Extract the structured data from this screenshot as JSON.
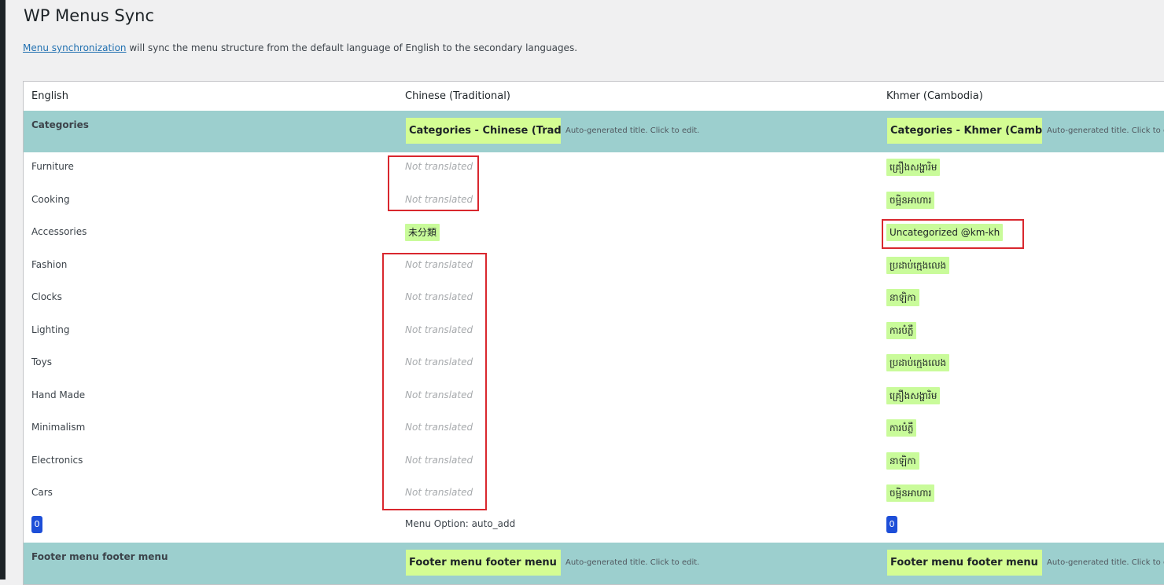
{
  "page": {
    "title": "WP Menus Sync",
    "intro_link": "Menu synchronization",
    "intro_text": " will sync the menu structure from the default language of English to the secondary languages."
  },
  "table": {
    "headers": [
      "English",
      "Chinese (Traditional)",
      "Khmer (Cambodia)"
    ],
    "groups": [
      {
        "label": "Categories",
        "zh_title": "Categories - Chinese (Traditional)",
        "km_title": "Categories - Khmer (Cambodia)",
        "auto_note": "Auto-generated title. Click to edit.",
        "rows": [
          {
            "en": "Furniture",
            "zh": "Not translated",
            "km": "គ្រឿងសង្ហារិម"
          },
          {
            "en": "Cooking",
            "zh": "Not translated",
            "km": "ចម្អិនអាហារ"
          },
          {
            "en": "Accessories",
            "zh": "未分類",
            "km": "Uncategorized @km-kh"
          },
          {
            "en": "Fashion",
            "zh": "Not translated",
            "km": "ប្រដាប់ក្មេងលេង"
          },
          {
            "en": "Clocks",
            "zh": "Not translated",
            "km": "នាឡិកា"
          },
          {
            "en": "Lighting",
            "zh": "Not translated",
            "km": "ការបំភ្លឺ"
          },
          {
            "en": "Toys",
            "zh": "Not translated",
            "km": "ប្រដាប់ក្មេងលេង"
          },
          {
            "en": "Hand Made",
            "zh": "Not translated",
            "km": "គ្រឿងសង្ហារិម"
          },
          {
            "en": "Minimalism",
            "zh": "Not translated",
            "km": "ការបំភ្លឺ"
          },
          {
            "en": "Electronics",
            "zh": "Not translated",
            "km": "នាឡិកា"
          },
          {
            "en": "Cars",
            "zh": "Not translated",
            "km": "ចម្អិនអាហារ"
          }
        ],
        "footer": {
          "en_count": "0",
          "menu_option": "Menu Option: auto_add",
          "km_count": "0"
        }
      },
      {
        "label": "Footer menu footer menu",
        "zh_title": "Footer menu footer menu - Chinese (Traditional)",
        "km_title": "Footer menu footer menu - Khmer (Cambodia)",
        "auto_note": "Auto-generated title. Click to edit."
      }
    ]
  },
  "colors": {
    "group_bg": "#9ccfce",
    "title_edit_bg": "#d4fd93",
    "tag_bg": "#c9fb9a",
    "highlight_box": "#d9272e",
    "badge_bg": "#1d4ed8"
  }
}
